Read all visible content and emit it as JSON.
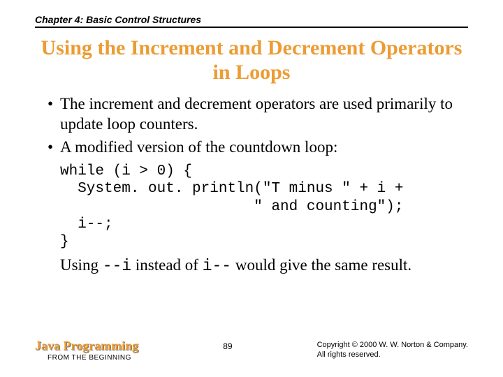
{
  "header": {
    "chapter": "Chapter 4: Basic Control Structures"
  },
  "title": "Using the Increment and Decrement Operators in Loops",
  "bullets": [
    "The increment and decrement operators are used primarily to update loop counters.",
    "A modified version of the countdown loop:"
  ],
  "code": "while (i > 0) {\n  System. out. println(\"T minus \" + i +\n                      \" and counting\");\n  i--;\n}",
  "result": {
    "pre": "Using ",
    "op1": "--i",
    "mid": " instead of ",
    "op2": "i--",
    "post": " would give the same result."
  },
  "footer": {
    "book_title": "Java Programming",
    "book_sub": "FROM THE BEGINNING",
    "page": "89",
    "copyright_l1": "Copyright © 2000 W. W. Norton & Company.",
    "copyright_l2": "All rights reserved."
  }
}
